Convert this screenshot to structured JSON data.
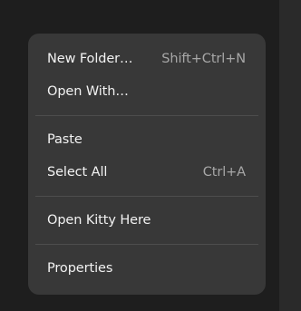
{
  "menu": {
    "items": [
      {
        "label": "New Folder…",
        "shortcut": "Shift+Ctrl+N"
      },
      {
        "label": "Open With…",
        "shortcut": ""
      },
      {
        "label": "Paste",
        "shortcut": ""
      },
      {
        "label": "Select All",
        "shortcut": "Ctrl+A"
      },
      {
        "label": "Open Kitty Here",
        "shortcut": ""
      },
      {
        "label": "Properties",
        "shortcut": ""
      }
    ]
  },
  "colors": {
    "background": "#1e1e1e",
    "menu_background": "#383838",
    "text": "#f2f2f2",
    "shortcut_text": "#a7a7a7",
    "separator": "#4d4d4d"
  }
}
